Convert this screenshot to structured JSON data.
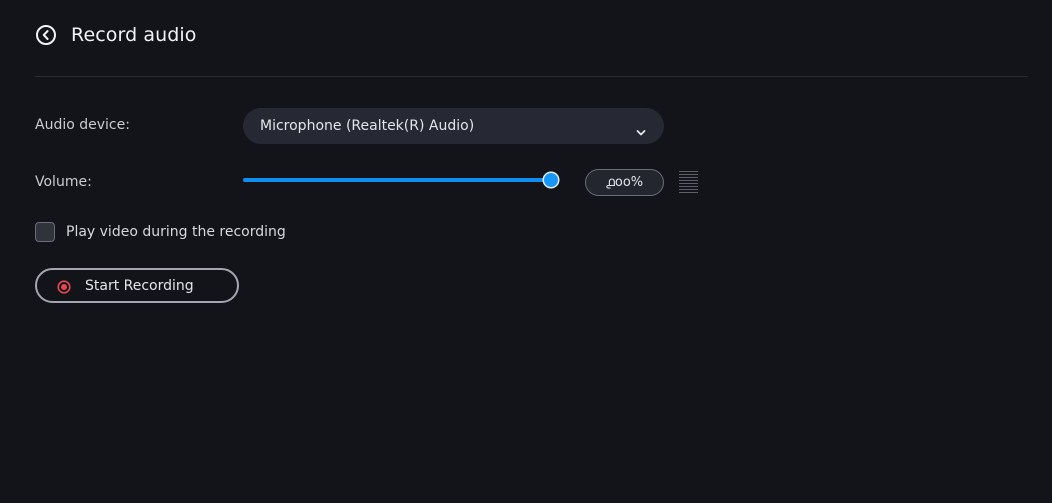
{
  "header": {
    "title": "Record audio",
    "back_icon": "back-circle-icon"
  },
  "audio_device": {
    "label": "Audio device:",
    "value": "Microphone (Realtek(R) Audio)",
    "icon": "chevron-down-icon"
  },
  "volume": {
    "label": "Volume:",
    "value_text": "൧oo%",
    "level": 1.0,
    "meter_icon": "level-meter-icon"
  },
  "play_video": {
    "label": "Play video during the recording",
    "checked": false
  },
  "record": {
    "label": "Start Recording",
    "icon": "record-icon"
  },
  "colors": {
    "background": "#131419",
    "accent": "#0f8ef0",
    "record_red": "#e4484f",
    "control_bg": "#262834"
  }
}
